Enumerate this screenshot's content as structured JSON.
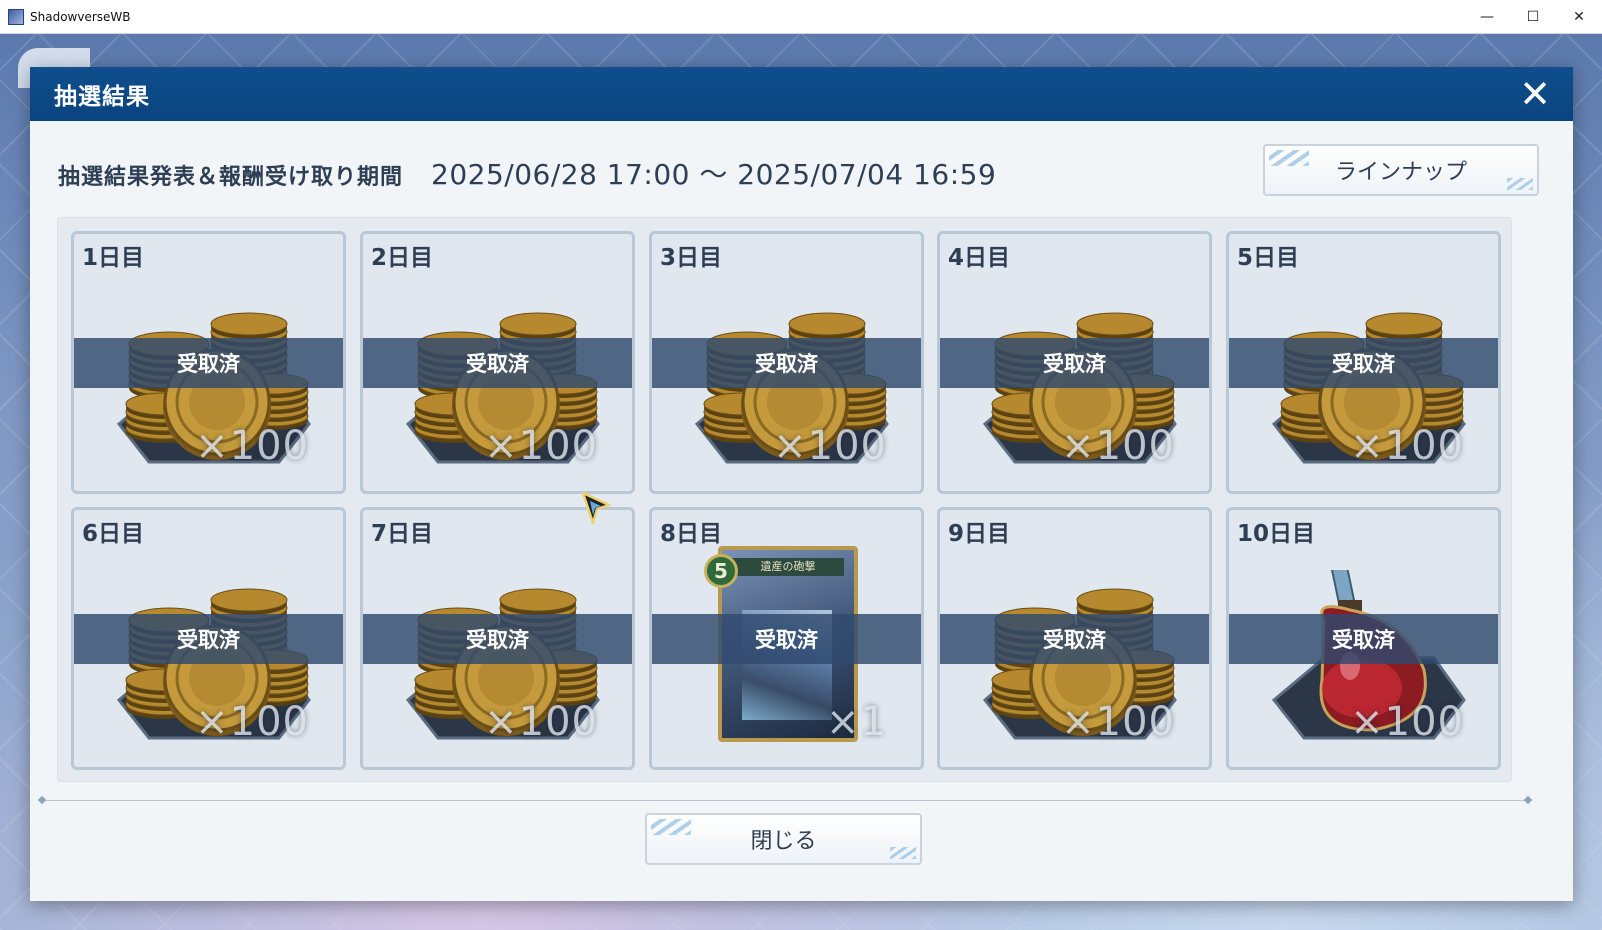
{
  "window": {
    "title": "ShadowverseWB",
    "controls": {
      "minimize": "—",
      "maximize": "☐",
      "close": "✕"
    }
  },
  "dialog": {
    "title": "抽選結果",
    "close_icon": "✕",
    "period_label": "抽選結果発表＆報酬受け取り期間",
    "period_value": "2025/06/28 17:00 ～ 2025/07/04 16:59",
    "lineup_button": "ラインナップ",
    "close_button": "閉じる"
  },
  "rewards": [
    {
      "day": "1日目",
      "item": "coin-stack-icon",
      "qty": "×100",
      "status": "受取済"
    },
    {
      "day": "2日目",
      "item": "coin-stack-icon",
      "qty": "×100",
      "status": "受取済"
    },
    {
      "day": "3日目",
      "item": "coin-stack-icon",
      "qty": "×100",
      "status": "受取済"
    },
    {
      "day": "4日目",
      "item": "coin-stack-icon",
      "qty": "×100",
      "status": "受取済"
    },
    {
      "day": "5日目",
      "item": "coin-stack-icon",
      "qty": "×100",
      "status": "受取済"
    },
    {
      "day": "6日目",
      "item": "coin-stack-icon",
      "qty": "×100",
      "status": "受取済"
    },
    {
      "day": "7日目",
      "item": "coin-stack-icon",
      "qty": "×100",
      "status": "受取済"
    },
    {
      "day": "8日目",
      "item": "card-icon",
      "card_cost": "5",
      "card_name": "遺産の砲撃",
      "qty": "×1",
      "status": "受取済"
    },
    {
      "day": "9日目",
      "item": "coin-stack-icon",
      "qty": "×100",
      "status": "受取済"
    },
    {
      "day": "10日目",
      "item": "potion-icon",
      "qty": "×100",
      "status": "受取済"
    }
  ],
  "colors": {
    "header": "#0e4f8c",
    "claimed_band": "#2f496e",
    "text": "#2e3e54"
  }
}
